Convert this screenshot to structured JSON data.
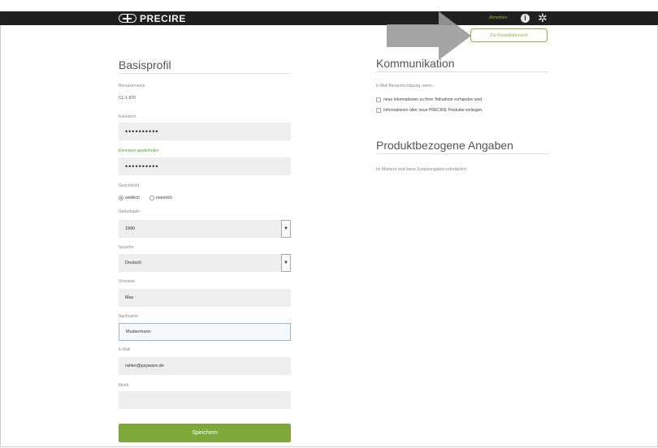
{
  "header": {
    "logo_text": "PRECIRE",
    "logout_label": "Abmelden",
    "info_icon": "info-icon",
    "settings_icon": "gear-icon"
  },
  "overview_button_label": "Zur Produktübersicht",
  "basisprofil": {
    "title": "Basisprofil",
    "username_label": "Benutzername",
    "username_value": "CL-1-970",
    "password_label": "Kennwort",
    "password_value": "••••••••••",
    "password_repeat_label": "Kennwort wiederholen",
    "password_repeat_value": "••••••••••",
    "gender_label": "Geschlecht",
    "gender_female": "weiblich",
    "gender_male": "männlich",
    "birthyear_label": "Geburtsjahr",
    "birthyear_value": "1990",
    "language_label": "Sprache",
    "language_value": "Deutsch",
    "firstname_label": "Vorname",
    "firstname_value": "Max",
    "lastname_label": "Nachname",
    "lastname_value": "Mustermann",
    "email_label": "E-Mail",
    "email_value": "rahier@psyware.de",
    "mobile_label": "Mobil",
    "mobile_value": "",
    "save_label": "Speichern"
  },
  "kommunikation": {
    "title": "Kommunikation",
    "email_notify_label": "E-Mail Benachrichtigung, wenn...",
    "option1": "neue Informationen zu Ihrer Teilnahme vorhanden sind.",
    "option2": "Informationen über neue PRECIRE Produkte vorliegen."
  },
  "produkt": {
    "title": "Produktbezogene Angaben",
    "text": "Im Moment sind keine Zusatzangaben erforderlich."
  },
  "colors": {
    "accent": "#8bb33d",
    "save_button": "#7fa83a",
    "header_bg": "#1f1f1f"
  }
}
